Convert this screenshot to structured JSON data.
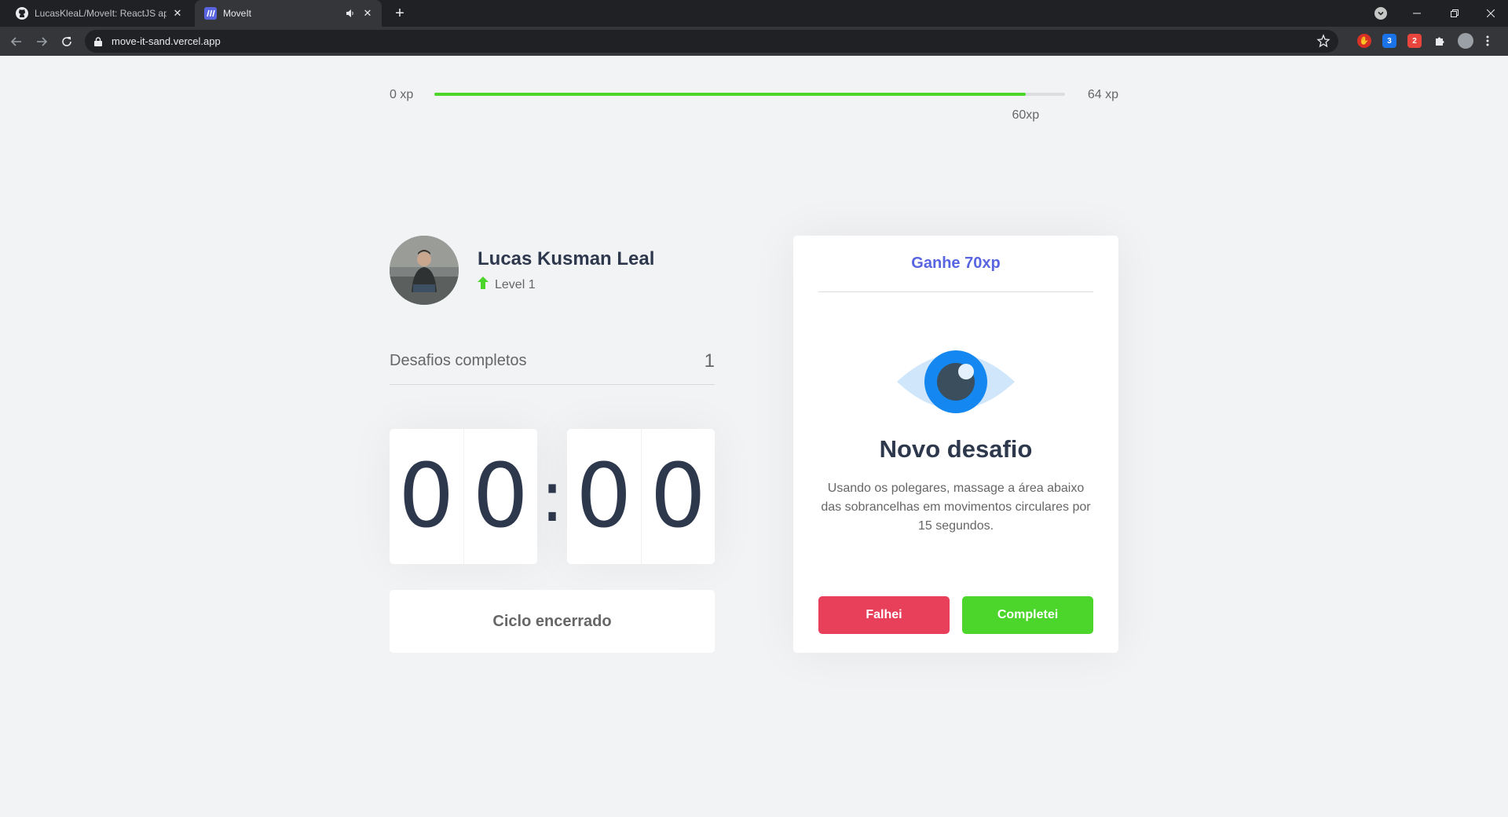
{
  "browser": {
    "tabs": [
      {
        "title": "LucasKleaL/MoveIt: ReactJS appli",
        "favicon": "github-icon",
        "active": false
      },
      {
        "title": "MoveIt",
        "favicon": "moveit-logo-icon",
        "active": true
      }
    ],
    "url": "move-it-sand.vercel.app"
  },
  "experience": {
    "min_label": "0 xp",
    "max_label": "64 xp",
    "current_label": "60xp",
    "progress_fraction": 0.9375
  },
  "profile": {
    "name": "Lucas Kusman Leal",
    "level_label": "Level 1"
  },
  "completed_challenges": {
    "label": "Desafios completos",
    "value": "1"
  },
  "countdown": {
    "minute_left": "0",
    "minute_right": "0",
    "second_left": "0",
    "second_right": "0",
    "separator": ":"
  },
  "cycle_button_label": "Ciclo encerrado",
  "challenge": {
    "header": "Ganhe 70xp",
    "icon": "eye-icon",
    "title": "Novo desafio",
    "description": "Usando os polegares, massage a área abaixo das sobrancelhas em movimentos circulares por 15 segundos.",
    "fail_label": "Falhei",
    "success_label": "Completei"
  },
  "colors": {
    "accent": "#5965e0",
    "success": "#4cd62b",
    "danger": "#e83f5b",
    "title": "#2e384d",
    "background": "#f2f3f5"
  }
}
